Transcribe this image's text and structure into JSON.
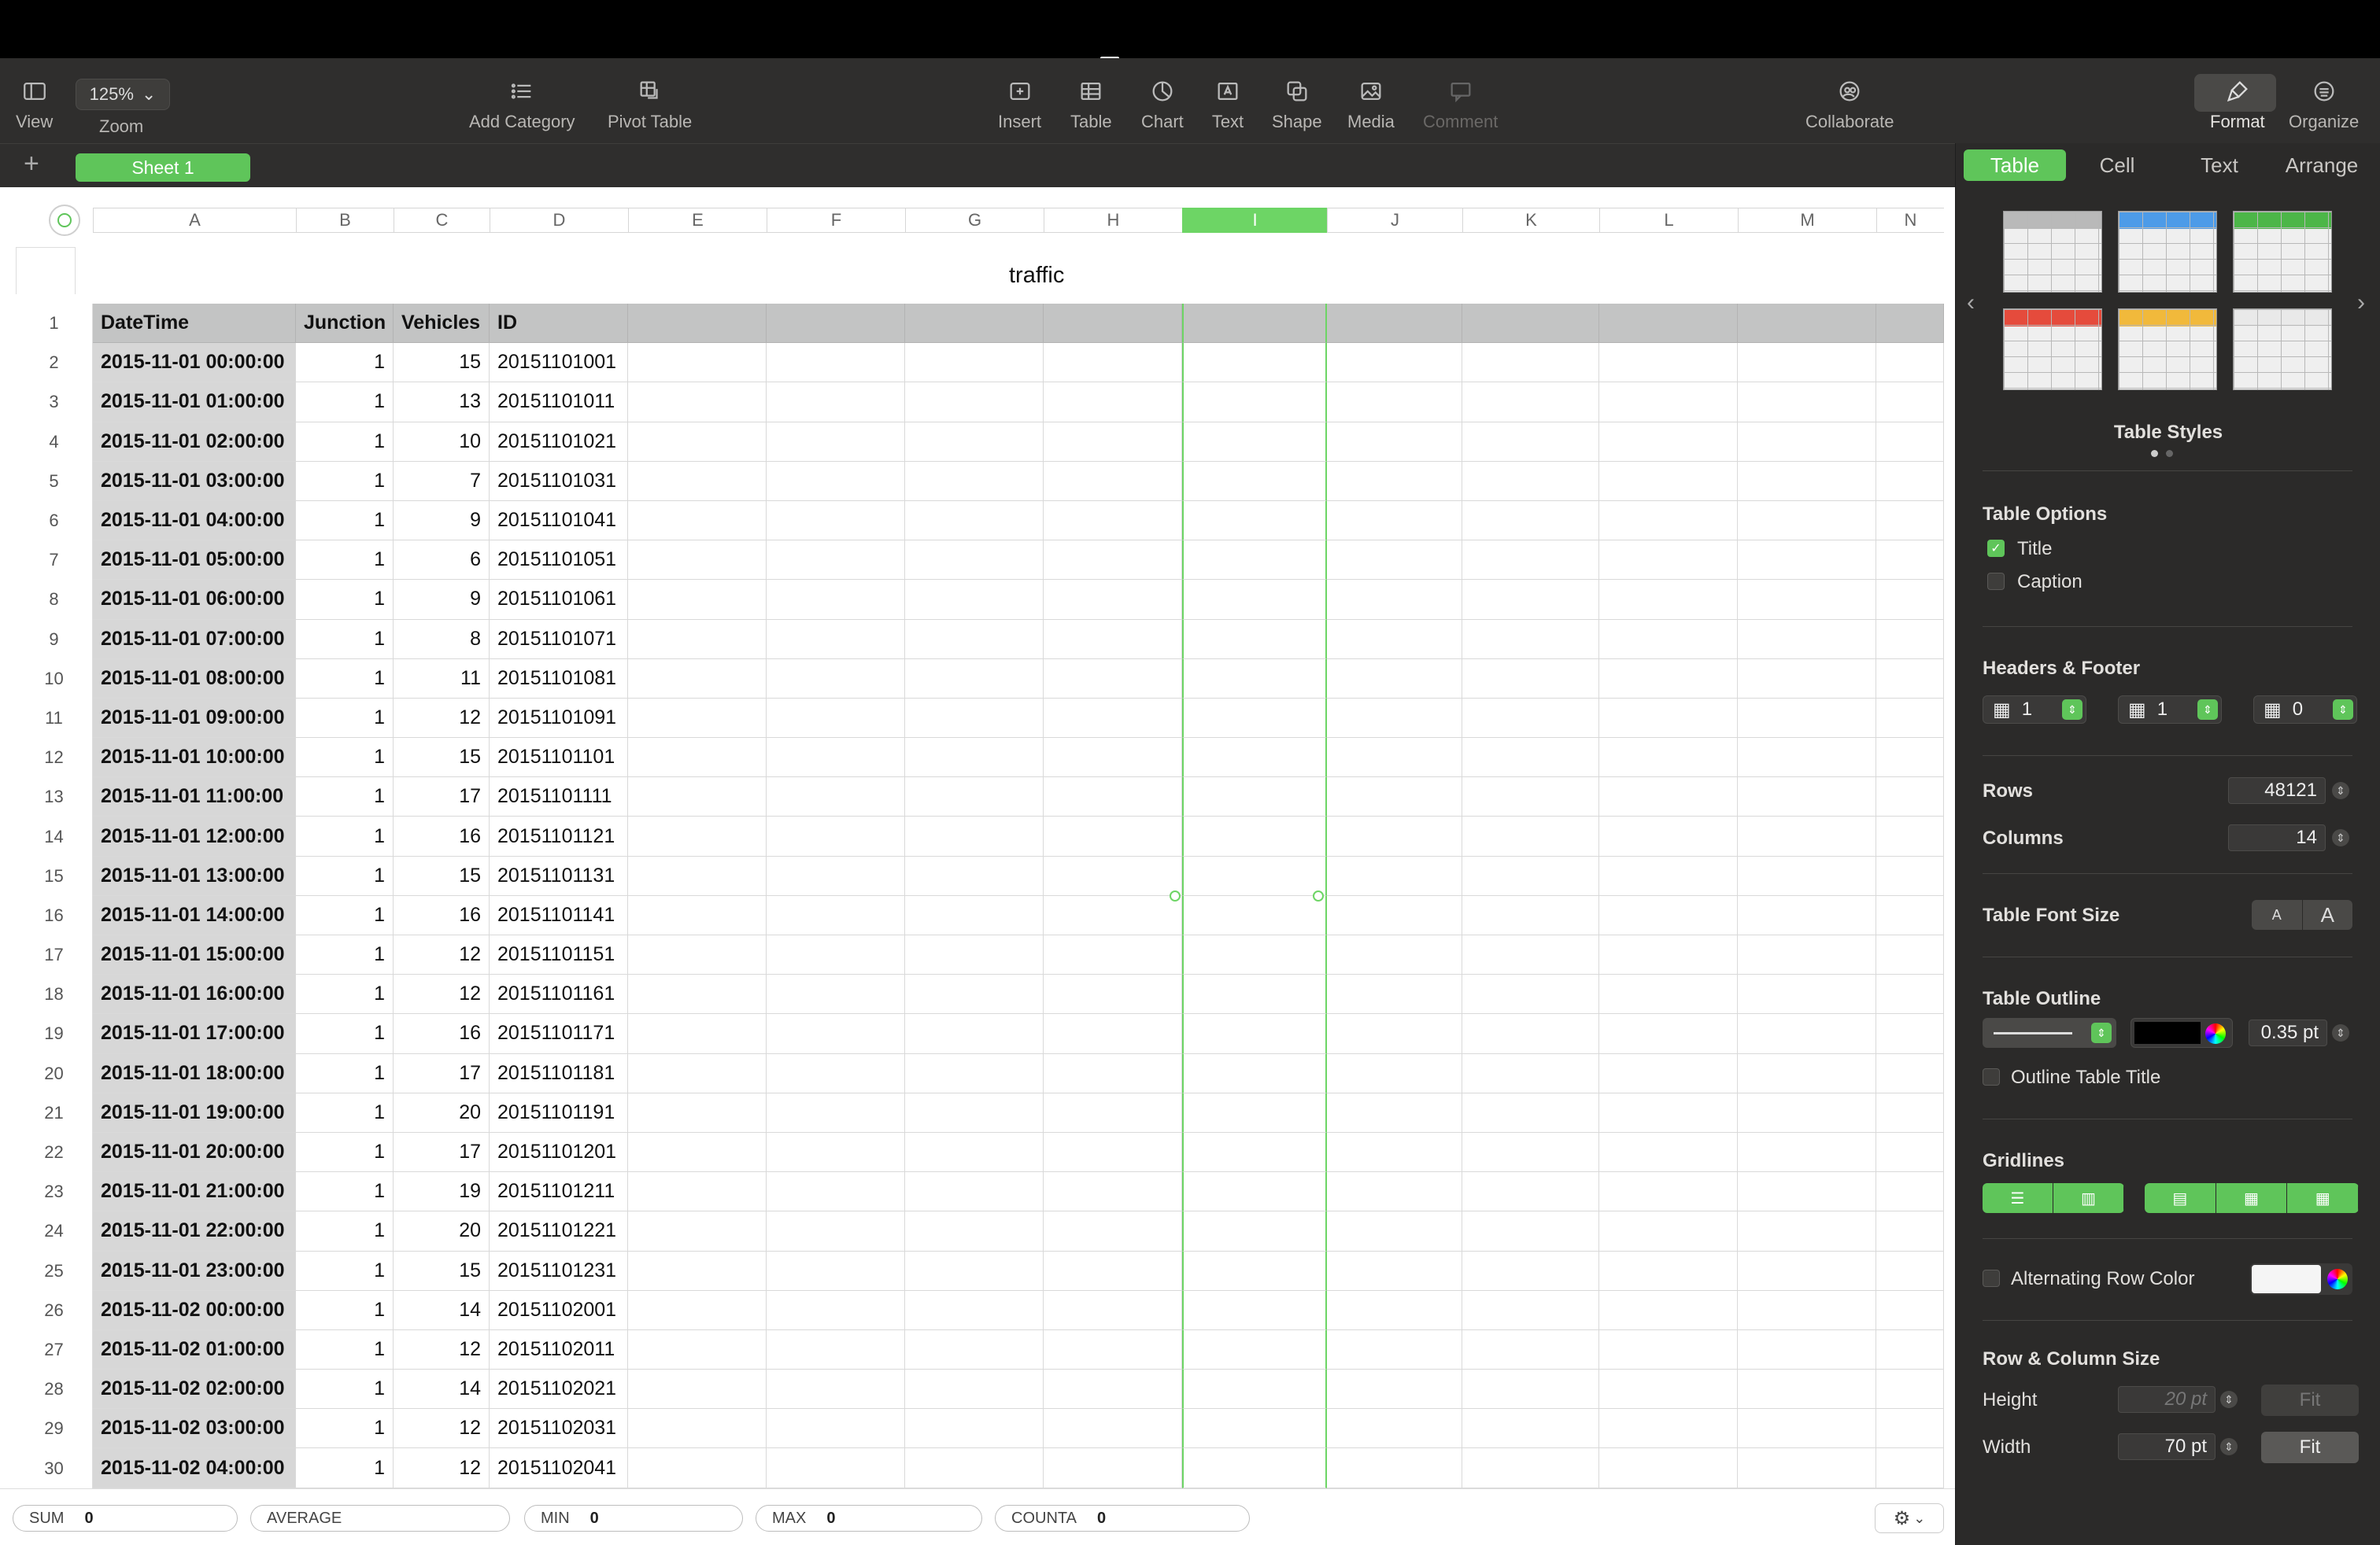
{
  "toolbar": {
    "view_label": "View",
    "zoom_value": "125%",
    "zoom_label": "Zoom",
    "add_category_label": "Add Category",
    "pivot_table_label": "Pivot Table",
    "insert_label": "Insert",
    "table_label": "Table",
    "chart_label": "Chart",
    "text_label": "Text",
    "shape_label": "Shape",
    "media_label": "Media",
    "comment_label": "Comment",
    "collaborate_label": "Collaborate",
    "format_label": "Format",
    "organize_label": "Organize"
  },
  "sheets": {
    "add_symbol": "+",
    "active_tab": "Sheet 1"
  },
  "columns": [
    "A",
    "B",
    "C",
    "D",
    "E",
    "F",
    "G",
    "H",
    "I",
    "J",
    "K",
    "L",
    "M",
    "N"
  ],
  "selected_column": "I",
  "table": {
    "title": "traffic",
    "headers": [
      "DateTime",
      "Junction",
      "Vehicles",
      "ID"
    ],
    "rows": [
      [
        "2015-11-01 00:00:00",
        "1",
        "15",
        "20151101001"
      ],
      [
        "2015-11-01 01:00:00",
        "1",
        "13",
        "20151101011"
      ],
      [
        "2015-11-01 02:00:00",
        "1",
        "10",
        "20151101021"
      ],
      [
        "2015-11-01 03:00:00",
        "1",
        "7",
        "20151101031"
      ],
      [
        "2015-11-01 04:00:00",
        "1",
        "9",
        "20151101041"
      ],
      [
        "2015-11-01 05:00:00",
        "1",
        "6",
        "20151101051"
      ],
      [
        "2015-11-01 06:00:00",
        "1",
        "9",
        "20151101061"
      ],
      [
        "2015-11-01 07:00:00",
        "1",
        "8",
        "20151101071"
      ],
      [
        "2015-11-01 08:00:00",
        "1",
        "11",
        "20151101081"
      ],
      [
        "2015-11-01 09:00:00",
        "1",
        "12",
        "20151101091"
      ],
      [
        "2015-11-01 10:00:00",
        "1",
        "15",
        "20151101101"
      ],
      [
        "2015-11-01 11:00:00",
        "1",
        "17",
        "20151101111"
      ],
      [
        "2015-11-01 12:00:00",
        "1",
        "16",
        "20151101121"
      ],
      [
        "2015-11-01 13:00:00",
        "1",
        "15",
        "20151101131"
      ],
      [
        "2015-11-01 14:00:00",
        "1",
        "16",
        "20151101141"
      ],
      [
        "2015-11-01 15:00:00",
        "1",
        "12",
        "20151101151"
      ],
      [
        "2015-11-01 16:00:00",
        "1",
        "12",
        "20151101161"
      ],
      [
        "2015-11-01 17:00:00",
        "1",
        "16",
        "20151101171"
      ],
      [
        "2015-11-01 18:00:00",
        "1",
        "17",
        "20151101181"
      ],
      [
        "2015-11-01 19:00:00",
        "1",
        "20",
        "20151101191"
      ],
      [
        "2015-11-01 20:00:00",
        "1",
        "17",
        "20151101201"
      ],
      [
        "2015-11-01 21:00:00",
        "1",
        "19",
        "20151101211"
      ],
      [
        "2015-11-01 22:00:00",
        "1",
        "20",
        "20151101221"
      ],
      [
        "2015-11-01 23:00:00",
        "1",
        "15",
        "20151101231"
      ],
      [
        "2015-11-02 00:00:00",
        "1",
        "14",
        "20151102001"
      ],
      [
        "2015-11-02 01:00:00",
        "1",
        "12",
        "20151102011"
      ],
      [
        "2015-11-02 02:00:00",
        "1",
        "14",
        "20151102021"
      ],
      [
        "2015-11-02 03:00:00",
        "1",
        "12",
        "20151102031"
      ],
      [
        "2015-11-02 04:00:00",
        "1",
        "12",
        "20151102041"
      ]
    ]
  },
  "status": {
    "sum_label": "SUM",
    "sum_value": "0",
    "average_label": "AVERAGE",
    "min_label": "MIN",
    "min_value": "0",
    "max_label": "MAX",
    "max_value": "0",
    "counta_label": "COUNTA",
    "counta_value": "0"
  },
  "inspector": {
    "tabs": [
      "Table",
      "Cell",
      "Text",
      "Arrange"
    ],
    "active_tab": "Table",
    "styles_title": "Table Styles",
    "style_colors": [
      "#b9b9b9",
      "#4d9be8",
      "#4cb648",
      "#e54b3c",
      "#f1b93b",
      "#e9e9e9"
    ],
    "table_options_title": "Table Options",
    "title_option": "Title",
    "title_checked": true,
    "caption_option": "Caption",
    "caption_checked": false,
    "headers_footer_title": "Headers & Footer",
    "header_rows": "1",
    "header_columns": "1",
    "footer_rows": "0",
    "rows_label": "Rows",
    "rows_value": "48121",
    "columns_label": "Columns",
    "columns_value": "14",
    "font_size_label": "Table Font Size",
    "font_small": "A",
    "font_large": "A",
    "outline_title": "Table Outline",
    "outline_width": "0.35 pt",
    "outline_color": "#000000",
    "outline_title_option": "Outline Table Title",
    "gridlines_title": "Gridlines",
    "alt_row_label": "Alternating Row Color",
    "row_col_size_title": "Row & Column Size",
    "height_label": "Height",
    "height_value": "20 pt",
    "width_label": "Width",
    "width_value": "70 pt",
    "fit_label": "Fit"
  },
  "colors": {
    "accent": "#5fc55a",
    "toolbar_bg": "#2f2e2d",
    "inspector_bg": "#2b2a29"
  }
}
